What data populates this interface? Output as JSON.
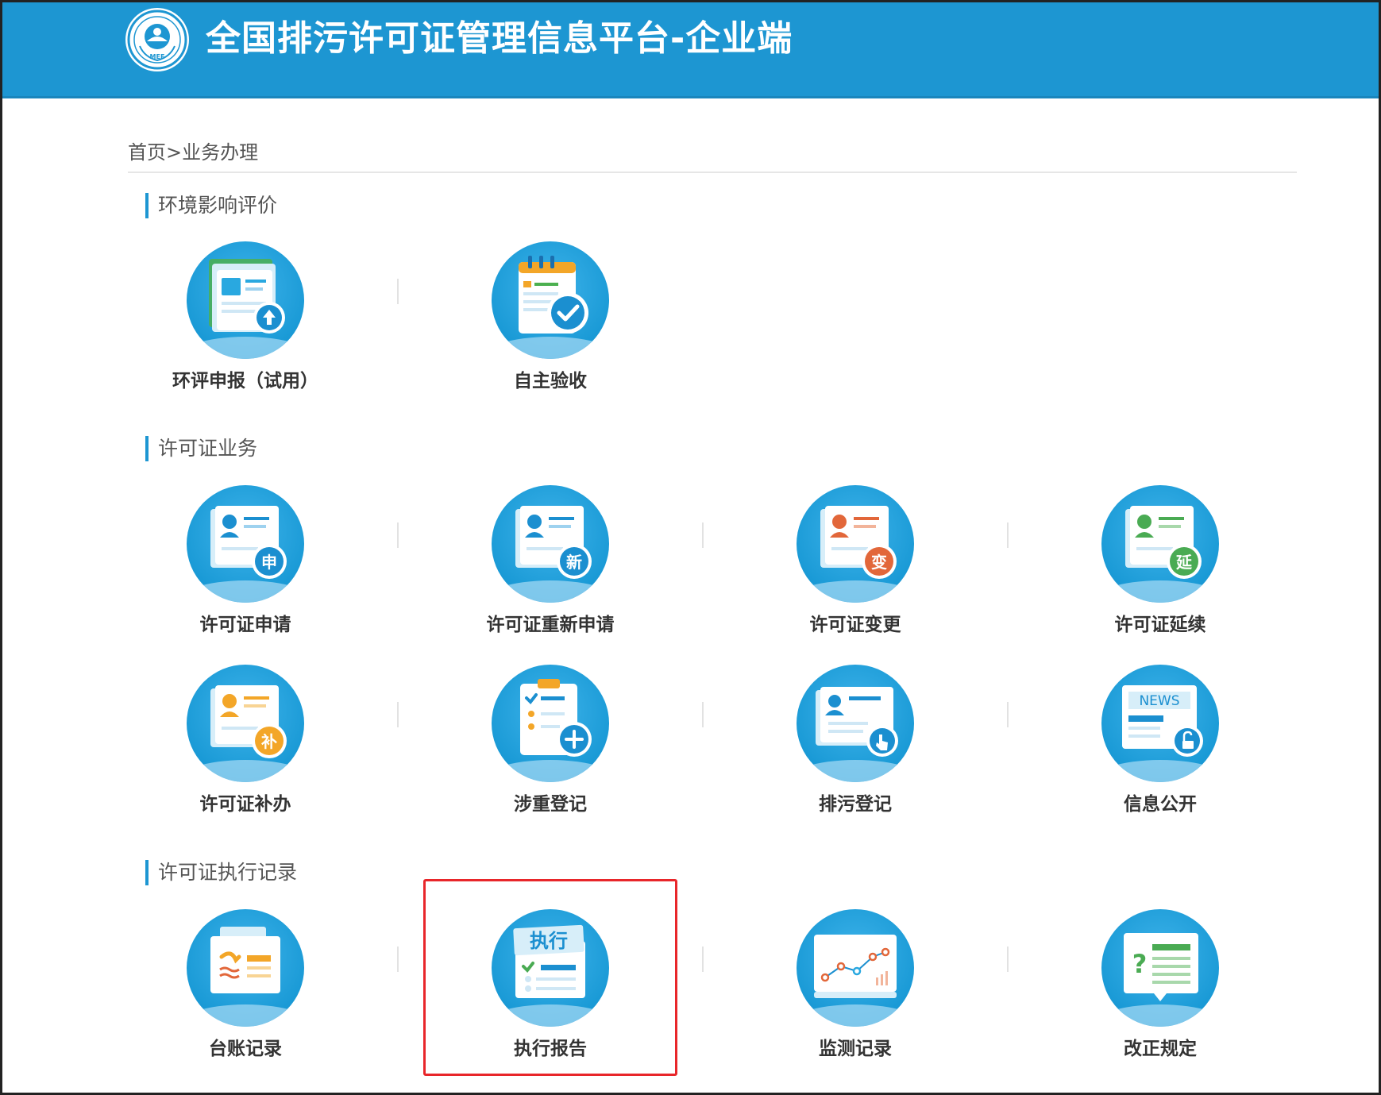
{
  "header": {
    "title": "全国排污许可证管理信息平台-企业端",
    "logo_icon": "mee-emblem-icon"
  },
  "breadcrumb": {
    "text": "首页>业务办理"
  },
  "sections": [
    {
      "title": "环境影响评价",
      "items": [
        {
          "label": "环评申报（试用）",
          "icon": "eia-upload-icon",
          "badge": ""
        },
        {
          "label": "自主验收",
          "icon": "self-acceptance-check-icon",
          "badge": ""
        }
      ]
    },
    {
      "title": "许可证业务",
      "items": [
        {
          "label": "许可证申请",
          "icon": "permit-apply-icon",
          "badge": "申"
        },
        {
          "label": "许可证重新申请",
          "icon": "permit-reapply-icon",
          "badge": "新"
        },
        {
          "label": "许可证变更",
          "icon": "permit-change-icon",
          "badge": "变"
        },
        {
          "label": "许可证延续",
          "icon": "permit-extend-icon",
          "badge": "延"
        },
        {
          "label": "许可证补办",
          "icon": "permit-reissue-icon",
          "badge": "补"
        },
        {
          "label": "涉重登记",
          "icon": "heavy-metal-register-icon",
          "badge": ""
        },
        {
          "label": "排污登记",
          "icon": "discharge-register-icon",
          "badge": ""
        },
        {
          "label": "信息公开",
          "icon": "info-disclosure-icon",
          "badge": "NEWS"
        }
      ]
    },
    {
      "title": "许可证执行记录",
      "items": [
        {
          "label": "台账记录",
          "icon": "ledger-record-icon",
          "badge": ""
        },
        {
          "label": "执行报告",
          "icon": "execution-report-icon",
          "badge": "执行"
        },
        {
          "label": "监测记录",
          "icon": "monitoring-record-icon",
          "badge": ""
        },
        {
          "label": "改正规定",
          "icon": "correction-rule-icon",
          "badge": "?"
        }
      ]
    }
  ],
  "colors": {
    "header_bg": "#1d96d2",
    "accent": "#1d96d2",
    "badge_blue": "#1b8fd0",
    "badge_orange": "#e2673a",
    "badge_green": "#4aab53",
    "badge_yellow": "#f3a628",
    "highlight": "#e8262a"
  }
}
